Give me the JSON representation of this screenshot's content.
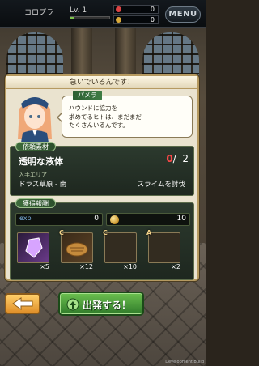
{
  "topbar": {
    "player_name": "コロプラ",
    "level": "Lv. 1",
    "xp_fraction": 0.1,
    "currency_1": "0",
    "currency_2": "0",
    "menu_label": "MENU"
  },
  "panel": {
    "title": "急いでいるんです！",
    "npc_name": "パメラ",
    "speech": "ハウンドに協力を\n求めてるヒトは、まだまだ\nたくさんいるんです。"
  },
  "request": {
    "section_label": "依頼素材",
    "item_name": "透明な液体",
    "have": "0",
    "separator": "/",
    "need": "2",
    "area_label": "入手エリア",
    "area_value": "ドラス草原 - 南",
    "area_action": "スライムを討伐"
  },
  "rewards": {
    "section_label": "獲得報酬",
    "exp_label": "exp",
    "exp_value": "0",
    "gold_value": "10",
    "items": [
      {
        "icon": "crystal-icon",
        "rank": "",
        "qty": "×5"
      },
      {
        "icon": "bread-icon",
        "rank": "C",
        "qty": "×12"
      },
      {
        "icon": "blank-item-icon",
        "rank": "C",
        "qty": "×10"
      },
      {
        "icon": "blank-item-icon",
        "rank": "A",
        "qty": "×2"
      }
    ]
  },
  "buttons": {
    "start_label": "出発する！"
  },
  "footer": {
    "dev_build": "Development Build"
  },
  "colors": {
    "accent_green": "#2f7a2a",
    "alert_red": "#ff4848",
    "back_orange": "#e0902a"
  }
}
